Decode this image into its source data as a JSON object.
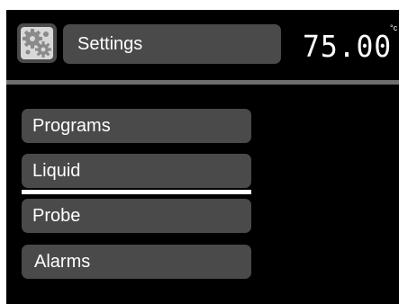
{
  "header": {
    "icon": "settings-gears-icon",
    "title": "Settings",
    "temperature": "75.00",
    "temperature_unit": "°c"
  },
  "menu": {
    "items": [
      {
        "label": "Programs"
      },
      {
        "label": "Liquid",
        "selected": true
      },
      {
        "label": "Probe"
      },
      {
        "label": "Alarms"
      }
    ]
  },
  "colors": {
    "background": "#000000",
    "panel": "#4a4a4a",
    "divider": "#6e6e6e",
    "highlight": "#ffffff",
    "text": "#ffffff"
  }
}
